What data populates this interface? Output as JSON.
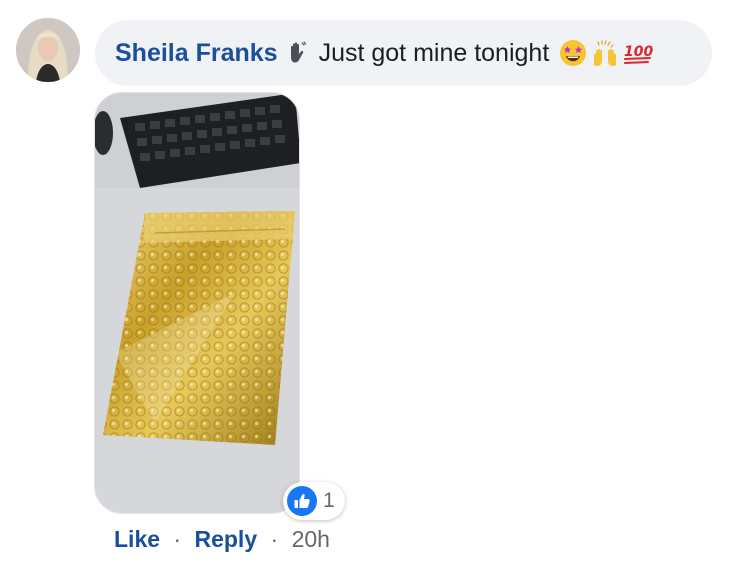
{
  "comment": {
    "author": "Sheila Franks",
    "text": "Just got mine tonight",
    "author_icon": "waving-hand-icon",
    "emojis": [
      "star-struck-icon",
      "raising-hands-icon",
      "hundred-points-icon"
    ],
    "hundred_label": "100"
  },
  "reactions": {
    "icon": "thumbs-up-icon",
    "count": "1",
    "color": "#1877f2"
  },
  "actions": {
    "like_label": "Like",
    "separator": "·",
    "reply_label": "Reply",
    "timestamp": "20h"
  },
  "colors": {
    "author": "#1b4e9b",
    "bubble": "#f0f2f5",
    "meta": "#65676b"
  }
}
